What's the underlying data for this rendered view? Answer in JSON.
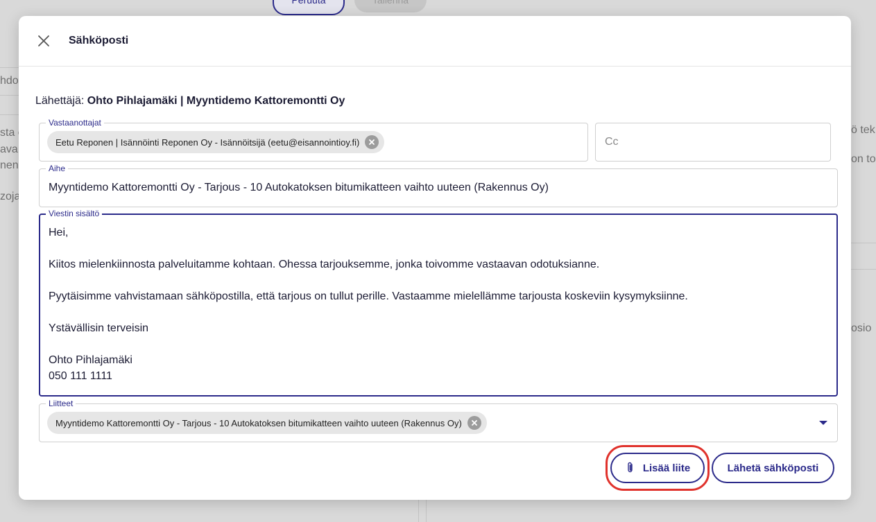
{
  "background": {
    "top_buttons": [
      "Peruuta",
      "Tallenna"
    ],
    "left_fragments": [
      "hdo",
      "sta e",
      "ava",
      "nen",
      "zoja"
    ],
    "right_fragments": [
      "ö tek",
      "on toi",
      "osio"
    ]
  },
  "modal": {
    "title": "Sähköposti",
    "sender_prefix": "Lähettäjä:",
    "sender_name": "Ohto Pihlajamäki | Myyntidemo Kattoremontti Oy"
  },
  "recipients": {
    "label": "Vastaanottajat",
    "chips": [
      "Eetu Reponen | Isännöinti Reponen Oy - Isännöitsijä (eetu@eisannointioy.fi)"
    ]
  },
  "cc": {
    "placeholder": "Cc"
  },
  "subject": {
    "label": "Aihe",
    "value": "Myyntidemo Kattoremontti Oy - Tarjous - 10 Autokatoksen bitumikatteen vaihto uuteen (Rakennus Oy)"
  },
  "message": {
    "label": "Viestin sisältö",
    "lines": [
      "Hei,",
      "",
      "Kiitos mielenkiinnosta palveluitamme kohtaan. Ohessa tarjouksemme, jonka toivomme vastaavan odotuksianne.",
      "",
      "Pyytäisimme vahvistamaan sähköpostilla, että tarjous on tullut perille. Vastaamme mielellämme tarjousta koskeviin kysymyksiinne.",
      "",
      "Ystävällisin terveisin",
      "",
      "Ohto Pihlajamäki",
      "050 111 1111"
    ]
  },
  "attachments": {
    "label": "Liitteet",
    "chips": [
      "Myyntidemo Kattoremontti Oy - Tarjous - 10 Autokatoksen bitumikatteen vaihto uuteen (Rakennus Oy)"
    ]
  },
  "actions": {
    "add_attachment": "Lisää liite",
    "send_email": "Lähetä sähköposti"
  },
  "colors": {
    "accent": "#2b2a8a",
    "highlight": "#e0322c",
    "backdrop": "#d9d9d9"
  },
  "icons": [
    "close-icon",
    "chip-remove-icon",
    "dropdown-caret-icon",
    "paperclip-icon"
  ]
}
